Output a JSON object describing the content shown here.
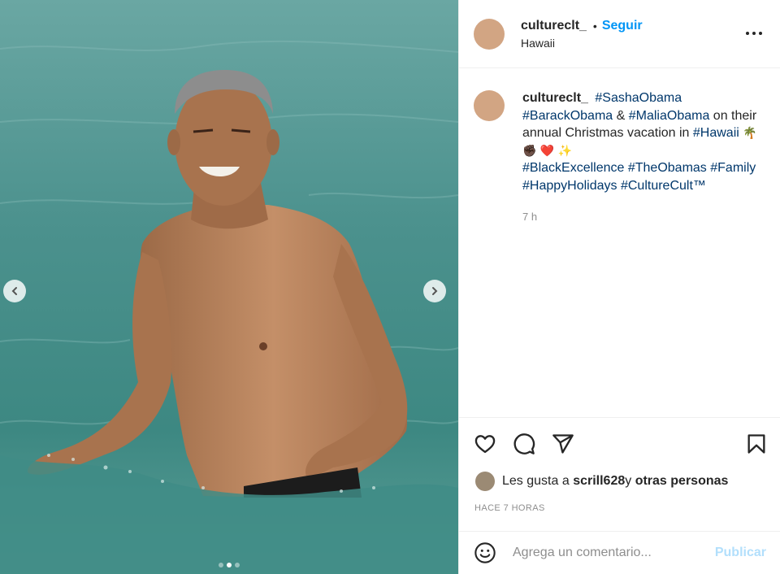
{
  "post": {
    "username": "cultureclt_",
    "follow_label": "Seguir",
    "location": "Hawaii",
    "caption": {
      "username": "cultureclt_",
      "line1_tag": "#SashaObama",
      "line2_tag1": "#BarackObama",
      "line2_amp": " & ",
      "line2_tag2": "#MaliaObama",
      "line2_text": " on their annual Christmas vacation in ",
      "line2_tag3": "#Hawaii",
      "emoji_palm": "🌴",
      "emoji_fist": "✊🏿",
      "emoji_heart": "❤️",
      "emoji_sparkles": "✨",
      "tags_line": [
        "#BlackExcellence",
        "#TheObamas",
        "#Family",
        "#HappyHolidays",
        "#CultureCult™"
      ],
      "time": "7 h"
    },
    "likes": {
      "prefix": "Les gusta a ",
      "user": "scrill628",
      "middle": " y ",
      "rest": "otras personas"
    },
    "posted_ago": "HACE 7 HORAS",
    "carousel": {
      "total": 3,
      "active_index": 1
    }
  },
  "comment": {
    "placeholder": "Agrega un comentario...",
    "publish_label": "Publicar"
  },
  "colors": {
    "accent": "#0095f6",
    "hashtag": "#00376b",
    "muted": "#8e8e8e",
    "like_red": "#ed4956"
  },
  "icons": [
    "chevron-left-icon",
    "chevron-right-icon",
    "more-icon",
    "heart-icon",
    "comment-icon",
    "share-icon",
    "bookmark-icon",
    "emoji-icon"
  ]
}
